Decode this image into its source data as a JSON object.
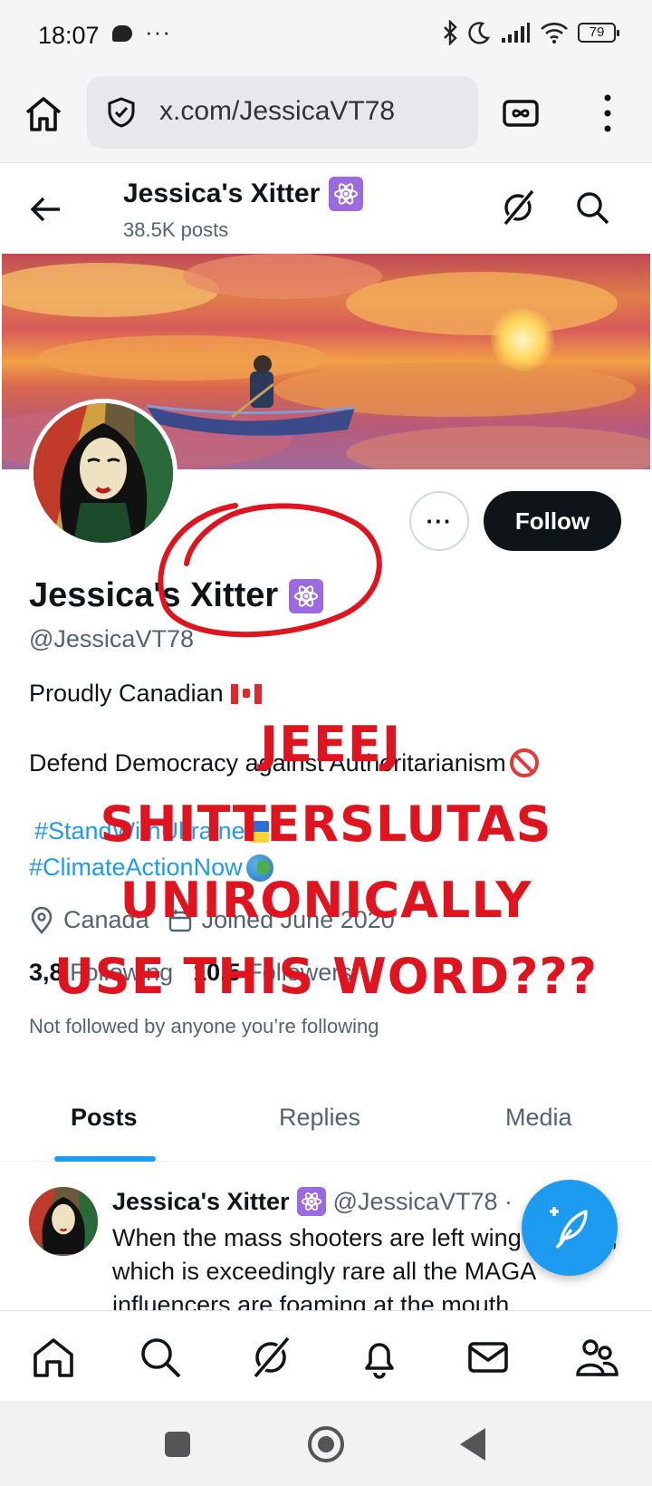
{
  "status_bar": {
    "time": "18:07",
    "more": "···",
    "battery": "79"
  },
  "browser": {
    "url": "x.com/JessicaVT78"
  },
  "header": {
    "title": "Jessica's Xitter",
    "post_count": "38.5K posts"
  },
  "profile": {
    "name": "Jessica's Xitter",
    "handle": "@JessicaVT78",
    "bio_line1": "Proudly Canadian",
    "bio_line2": "Defend Democracy against Authoritarianism",
    "hashtag1": "#StandWithUkraine",
    "hashtag2": "#ClimateActionNow",
    "location": "Canada",
    "joined": "Joined June 2020",
    "following_count": "3,8",
    "following_label": "Following",
    "followers_count": "10.5",
    "followers_label": "Followers",
    "not_followed": "Not followed by anyone you’re following"
  },
  "actions": {
    "more": "···",
    "follow": "Follow"
  },
  "tabs": [
    "Posts",
    "Replies",
    "Media"
  ],
  "post": {
    "author": "Jessica's Xitter",
    "handle": "@JessicaVT78 ·",
    "text": "When the mass shooters are left wing or trans, which is exceedingly rare all the MAGA influencers are foaming at the mouth"
  },
  "overlay": {
    "line1": "JEEEJ",
    "line2": "SHITTERSLUTAS",
    "line3": "UNIRONICALLY",
    "line4": "USE THIS WORD???"
  },
  "colors": {
    "accent": "#1d9bf0",
    "badge": "#9b6ae0",
    "overlay_red": "#e0141e",
    "text": "#0f1419",
    "muted": "#536471"
  },
  "icons": {
    "browser": [
      "home-icon",
      "shield-icon",
      "tab-switcher-icon",
      "kebab-menu-icon"
    ],
    "header": [
      "back-arrow-icon",
      "grok-icon",
      "search-icon"
    ],
    "bottom_nav": [
      "home-icon",
      "search-icon",
      "grok-icon",
      "bell-icon",
      "mail-icon",
      "communities-icon"
    ]
  }
}
